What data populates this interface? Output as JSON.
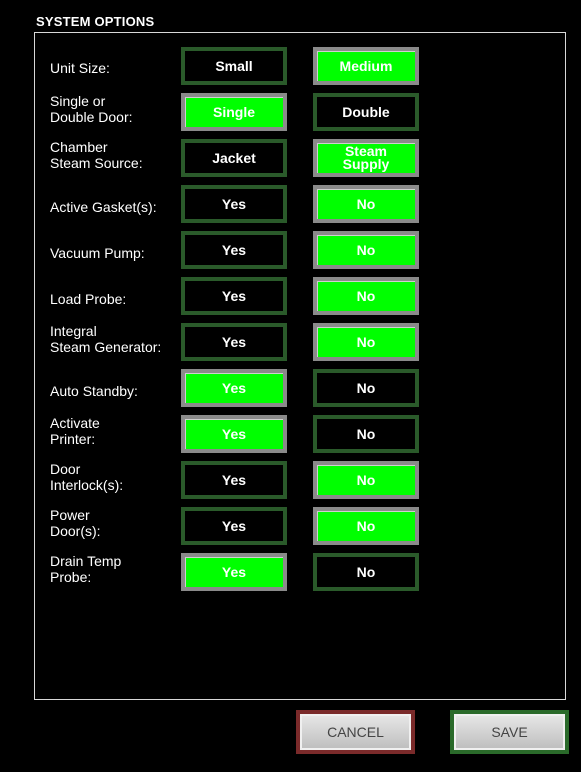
{
  "header": {
    "title": "SYSTEM OPTIONS"
  },
  "options": [
    {
      "label": "Unit Size:",
      "choices": [
        "Small",
        "Medium"
      ],
      "selected": 1
    },
    {
      "label": "Single or\nDouble Door:",
      "choices": [
        "Single",
        "Double"
      ],
      "selected": 0
    },
    {
      "label": "Chamber\nSteam Source:",
      "choices": [
        "Jacket",
        "Steam\nSupply"
      ],
      "selected": 1
    },
    {
      "label": "Active Gasket(s):",
      "choices": [
        "Yes",
        "No"
      ],
      "selected": 1
    },
    {
      "label": "Vacuum Pump:",
      "choices": [
        "Yes",
        "No"
      ],
      "selected": 1
    },
    {
      "label": "Load Probe:",
      "choices": [
        "Yes",
        "No"
      ],
      "selected": 1
    },
    {
      "label": "Integral\nSteam Generator:",
      "choices": [
        "Yes",
        "No"
      ],
      "selected": 1
    },
    {
      "label": "Auto Standby:",
      "choices": [
        "Yes",
        "No"
      ],
      "selected": 0
    },
    {
      "label": "Activate\nPrinter:",
      "choices": [
        "Yes",
        "No"
      ],
      "selected": 0
    },
    {
      "label": "Door\nInterlock(s):",
      "choices": [
        "Yes",
        "No"
      ],
      "selected": 1
    },
    {
      "label": "Power\nDoor(s):",
      "choices": [
        "Yes",
        "No"
      ],
      "selected": 1
    },
    {
      "label": "Drain Temp\nProbe:",
      "choices": [
        "Yes",
        "No"
      ],
      "selected": 0
    }
  ],
  "buttons": {
    "cancel": "CANCEL",
    "save": "SAVE"
  },
  "colors": {
    "selected": "#00ff00",
    "unselected_border": "#2a5a2a"
  }
}
